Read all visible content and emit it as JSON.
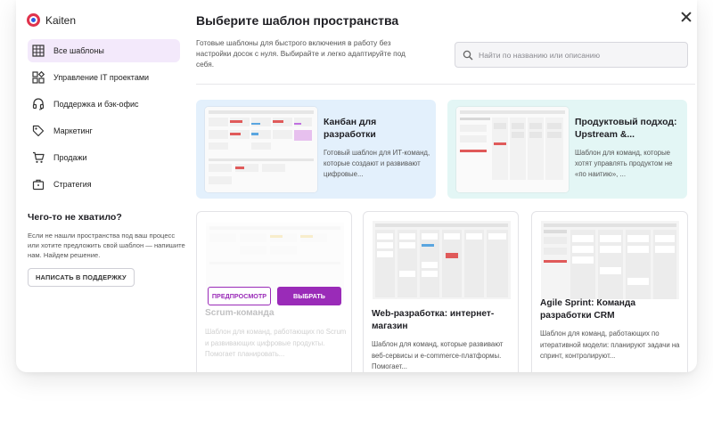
{
  "app": {
    "name": "Kaiten"
  },
  "modal": {
    "title": "Выберите шаблон пространства",
    "subtitle": "Готовые шаблоны для быстрого включения в работу без настройки досок с нуля. Выбирайте и легко адаптируйте под себя.",
    "search_placeholder": "Найти по названию или описанию"
  },
  "sidebar": {
    "items": [
      {
        "label": "Все шаблоны",
        "icon": "grid-icon",
        "active": true
      },
      {
        "label": "Управление IT проектами",
        "icon": "blocks-icon",
        "active": false
      },
      {
        "label": "Поддержка и бэк-офис",
        "icon": "headset-icon",
        "active": false
      },
      {
        "label": "Маркетинг",
        "icon": "tag-icon",
        "active": false
      },
      {
        "label": "Продажи",
        "icon": "cart-icon",
        "active": false
      },
      {
        "label": "Стратегия",
        "icon": "briefcase-icon",
        "active": false
      }
    ],
    "missing": {
      "title": "Чего-то не хватило?",
      "text": "Если не нашли пространства под ваш процесс или хотите предложить свой шаблон — напишите нам. Найдем решение.",
      "button": "НАПИСАТЬ В ПОДДЕРЖКУ"
    }
  },
  "featured": [
    {
      "title": "Канбан для разработки",
      "desc": "Готовый шаблон для ИТ-команд, которые создают и развивают цифровые...",
      "bg": "#e3f0fc"
    },
    {
      "title": "Продуктовый подход: Upstream &...",
      "desc": "Шаблон для команд, которые хотят управлять продуктом не «по наитию», ...",
      "bg": "#e3f6f5"
    }
  ],
  "cards": [
    {
      "title": "Scrum-команда",
      "desc": "Шаблон для команд, работающих по Scrum и развивающих цифровые продукты. Помогает планировать...",
      "preview_button": "ПРЕДПРОСМОТР",
      "choose_button": "ВЫБРАТЬ"
    },
    {
      "title": "Web-разработка: интернет-магазин",
      "desc": "Шаблон для команд, которые развивают веб-сервисы и e-commerce-платформы. Помогает..."
    },
    {
      "title": "Agile Sprint: Команда разработки CRM",
      "desc": "Шаблон для команд, работающих по итеративной модели: планируют задачи на спринт, контролируют..."
    }
  ],
  "colors": {
    "accent": "#9a2bb8",
    "active_nav_bg": "#f3e9fb"
  }
}
